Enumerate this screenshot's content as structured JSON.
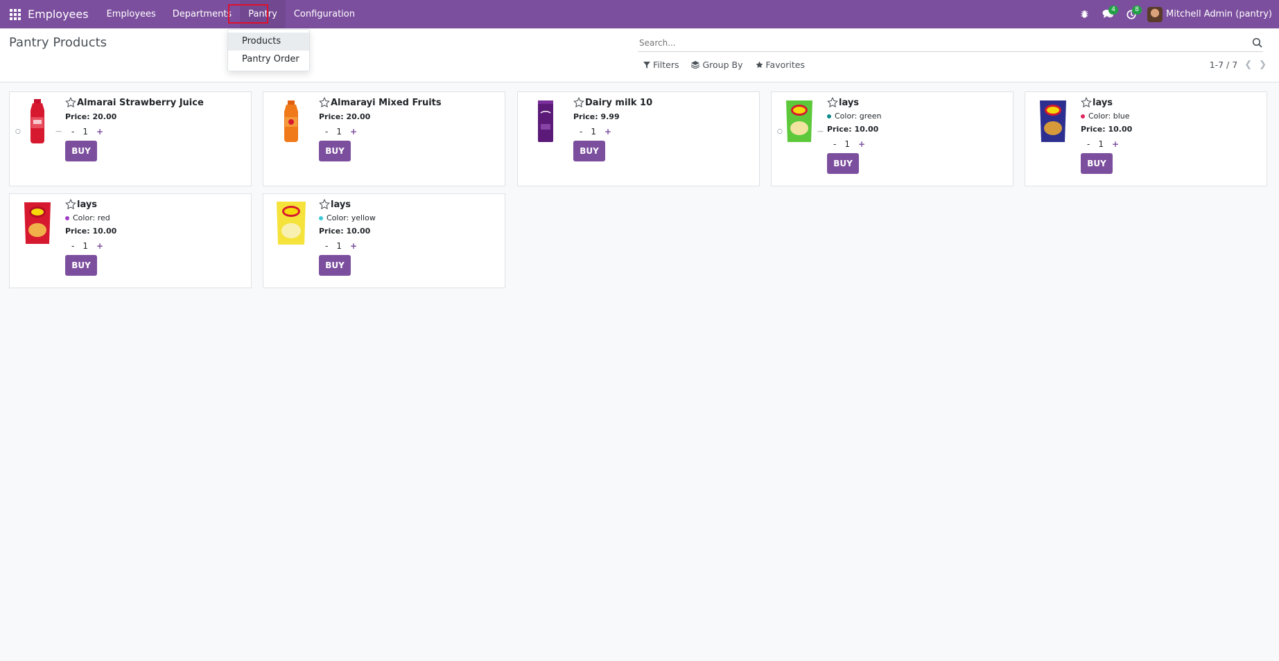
{
  "navbar": {
    "brand": "Employees",
    "menu": [
      "Employees",
      "Departments",
      "Pantry",
      "Configuration"
    ],
    "messages_count": "4",
    "activities_count": "8",
    "user_name": "Mitchell Admin (pantry)",
    "accent_color": "#7c4f9e"
  },
  "dropdown": {
    "items": [
      "Products",
      "Pantry Order"
    ]
  },
  "control_panel": {
    "title": "Pantry Products",
    "search_placeholder": "Search...",
    "filters_label": "Filters",
    "group_by_label": "Group By",
    "favorites_label": "Favorites",
    "pager": "1-7 / 7"
  },
  "products": [
    {
      "name": "Almarai Strawberry Juice",
      "price": "Price: 20.00",
      "qty": "1",
      "buy": "BUY",
      "color": ""
    },
    {
      "name": "Almarayi Mixed Fruits",
      "price": "Price: 20.00",
      "qty": "1",
      "buy": "BUY",
      "color": ""
    },
    {
      "name": "Dairy milk 10",
      "price": "Price: 9.99",
      "qty": "1",
      "buy": "BUY",
      "color": ""
    },
    {
      "name": "lays",
      "price": "Price: 10.00",
      "qty": "1",
      "buy": "BUY",
      "color": "Color: green",
      "dot": "#0b8a8a"
    },
    {
      "name": "lays",
      "price": "Price: 10.00",
      "qty": "1",
      "buy": "BUY",
      "color": "Color: blue",
      "dot": "#e0245e"
    },
    {
      "name": "lays",
      "price": "Price: 10.00",
      "qty": "1",
      "buy": "BUY",
      "color": "Color: red",
      "dot": "#a03cc8"
    },
    {
      "name": "lays",
      "price": "Price: 10.00",
      "qty": "1",
      "buy": "BUY",
      "color": "Color: yellow",
      "dot": "#3cc8d8"
    }
  ],
  "qty_minus": "-",
  "qty_plus": "+"
}
